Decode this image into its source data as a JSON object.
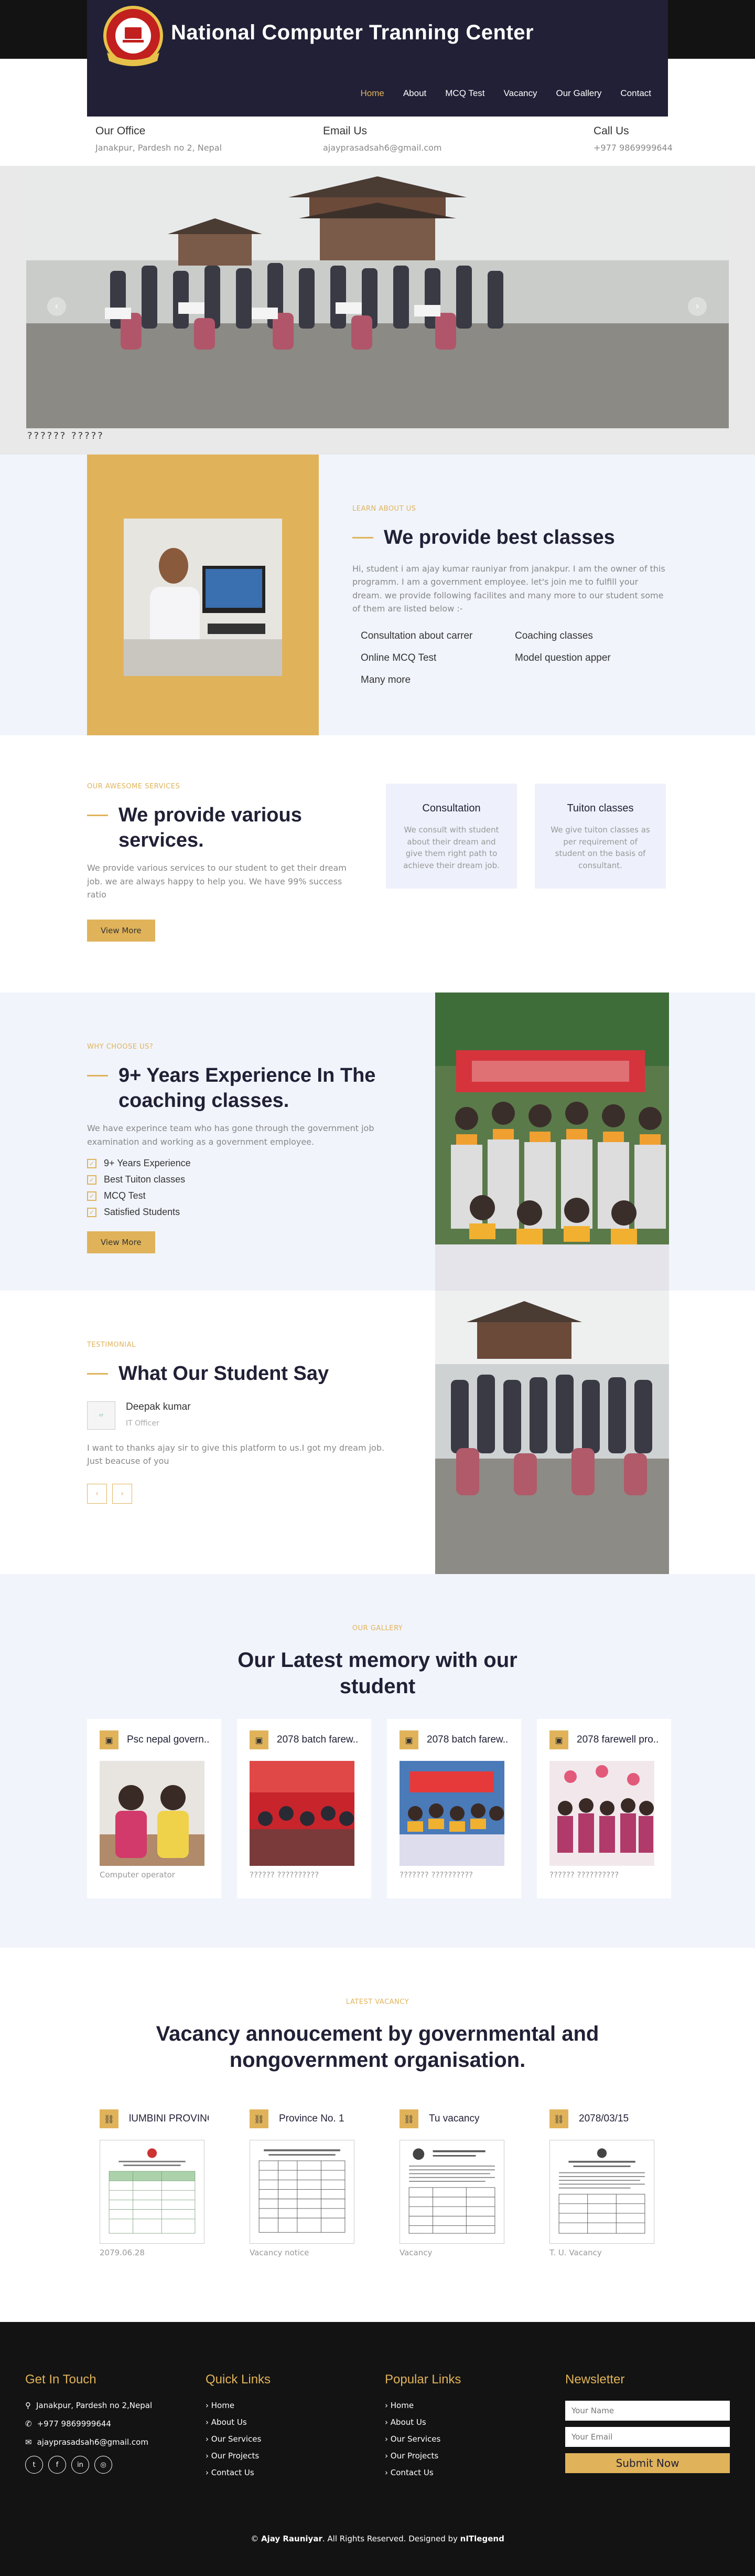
{
  "brand": {
    "title": "National Computer Tranning Center",
    "accent": "#e0b35a",
    "dark": "#212036"
  },
  "nav": [
    {
      "label": "Home",
      "active": true
    },
    {
      "label": "About"
    },
    {
      "label": "MCQ Test"
    },
    {
      "label": "Vacancy"
    },
    {
      "label": "Our Gallery"
    },
    {
      "label": "Contact"
    }
  ],
  "contact": {
    "office_title": "Our Office",
    "office_value": "Janakpur, Pardesh no 2, Nepal",
    "email_title": "Email Us",
    "email_value": "ajayprasadsah6@gmail.com",
    "call_title": "Call Us",
    "call_value": "+977 9869999644"
  },
  "slider": {
    "caption": "?????? ?????",
    "prev": "‹",
    "next": "›"
  },
  "about": {
    "label": "LEARN ABOUT US",
    "heading": "We provide best classes",
    "text": "Hi, student i am ajay kumar rauniyar from janakpur. I am the owner of this programm. I am a government employee. let's join me to fulfill your dream. we provide following facilites and many more to our student some of them are listed below :-",
    "features": [
      "Consultation about carrer",
      "Coaching classes",
      "Online MCQ Test",
      "Model question apper",
      "Many more"
    ]
  },
  "services": {
    "label": "OUR AWESOME SERVICES",
    "heading": "We provide various services.",
    "text": "We provide various services to our student to get their dream job. we are always happy to help you. We have 99% success ratio",
    "button": "View More",
    "cards": [
      {
        "title": "Consultation",
        "desc": "We consult with student about their dream and give them right path to achieve their dream job."
      },
      {
        "title": "Tuiton classes",
        "desc": "We give tuiton classes as per requirement of student on the basis of consultant."
      }
    ]
  },
  "why": {
    "label": "WHY CHOOSE US?",
    "heading": "9+ Years Experience In The coaching classes.",
    "text": "We have experince team who has gone through the government job examination and working as a government employee.",
    "checks": [
      "9+ Years Experience",
      "Best Tuiton classes",
      "MCQ Test",
      "Satisfied Students"
    ],
    "button": "View More"
  },
  "testimonial": {
    "label": "TESTIMONIAL",
    "heading": "What Our Student Say",
    "name": "Deepak kumar",
    "role": "IT Officer",
    "quote": "I want to thanks ajay sir to give this platform to us.I got my dream job. Just beacuse of you",
    "prev": "‹",
    "next": "›"
  },
  "gallery": {
    "label": "OUR GALLERY",
    "heading": "Our Latest memory with our student",
    "items": [
      {
        "title": "Psc nepal govern...",
        "caption": "Computer operator"
      },
      {
        "title": "2078 batch farew...",
        "caption": "?????? ??????????"
      },
      {
        "title": "2078 batch farew...",
        "caption": "??????? ??????????"
      },
      {
        "title": "2078 farewell pro...",
        "caption": "?????? ??????????"
      }
    ]
  },
  "vacancy": {
    "label": "LATEST VACANCY",
    "heading": "Vacancy annoucement by governmental and nongovernment organisation.",
    "items": [
      {
        "title": "lUMBINI PROVINC...",
        "caption": "2079.06.28"
      },
      {
        "title": "Province No. 1",
        "caption": "Vacancy notice"
      },
      {
        "title": "Tu vacancy",
        "caption": "Vacancy"
      },
      {
        "title": "2078/03/15",
        "caption": "T. U. Vacancy"
      }
    ]
  },
  "footer": {
    "touch_title": "Get In Touch",
    "address": "Janakpur, Pardesh no 2,Nepal",
    "phone": "+977 9869999644",
    "email": "ajayprasadsah6@gmail.com",
    "quick_title": "Quick Links",
    "quick": [
      "Home",
      "About Us",
      "Our Services",
      "Our Projects",
      "Contact Us"
    ],
    "popular_title": "Popular Links",
    "popular": [
      "Home",
      "About Us",
      "Our Services",
      "Our Projects",
      "Contact Us"
    ],
    "news_title": "Newsletter",
    "name_placeholder": "Your Name",
    "email_placeholder": "Your Email",
    "submit": "Submit Now",
    "copy_prefix": "© ",
    "copy_owner": "Ajay Rauniyar",
    "copy_mid": ". All Rights Reserved. Designed by ",
    "copy_designer": "nITlegend"
  }
}
